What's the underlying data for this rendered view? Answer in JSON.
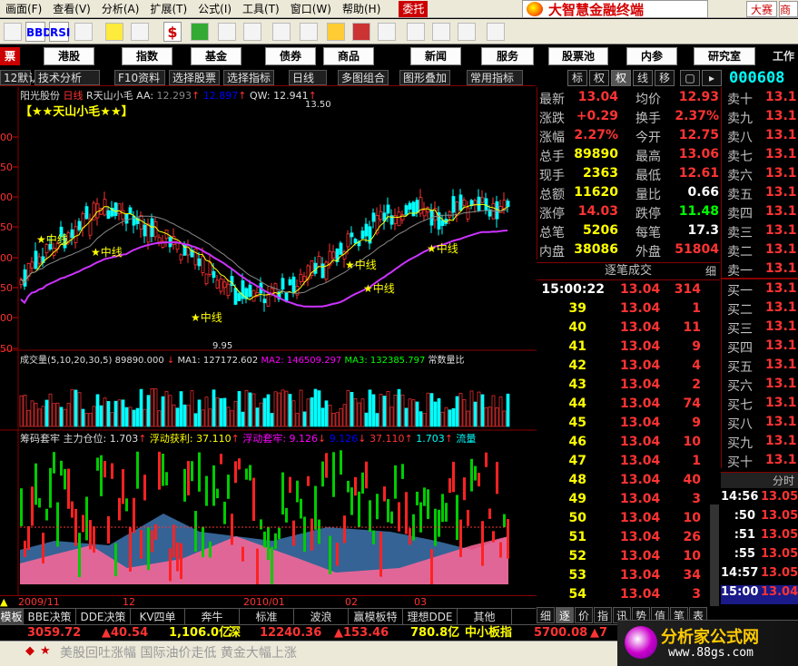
{
  "menu": [
    "画面(F)",
    "查看(V)",
    "分析(A)",
    "扩展(T)",
    "公式(I)",
    "工具(T)",
    "窗口(W)",
    "帮助(H)"
  ],
  "trust": "委托",
  "brand": "大智慧金融终端",
  "dasai": "大赛",
  "shang": "商",
  "toolbar": {
    "bbd": "BBD",
    "rsi": "RSI",
    "dollar": "$"
  },
  "nav": {
    "first": "票",
    "items": [
      "港股",
      "指数",
      "基金",
      "债券",
      "商品",
      "新闻",
      "服务",
      "股票池",
      "内参",
      "研究室"
    ],
    "extra": "工作"
  },
  "toolrow": [
    "12默认",
    "技术分析",
    "F10资料",
    "选择股票",
    "选择指标",
    "日线",
    "多图组合",
    "图形叠加",
    "常用指标"
  ],
  "tabs": [
    "标",
    "权",
    "权",
    "线",
    "移"
  ],
  "stock_code": "000608",
  "chart": {
    "stock_name": "阳光股份",
    "period": "日线",
    "formula": "R天山小毛",
    "aa_label": "AA:",
    "aa_value": "12.293",
    "bb_value": "12.897",
    "qw_label": "QW:",
    "qw_value": "12.941",
    "title_tag": "【★★天山小毛★★】",
    "high_price": "13.50",
    "low_price": "9.95",
    "middle_label": "★中线",
    "y_ticks": [
      "00",
      "50",
      "00",
      "50",
      "00",
      "50",
      "00",
      "50",
      "00",
      "50"
    ],
    "vol": {
      "title": "成交量(5,10,20,30,5)",
      "v": "89890.000",
      "ma1": "MA1: 127172.602",
      "ma2": "MA2: 146509.297",
      "ma3": "MA3: 132385.797",
      "tail": "常数量比"
    },
    "chip": {
      "title": "筹码套牢",
      "main": "主力仓位: 1.703",
      "float_profit": "浮动获利: 37.110",
      "float_loss": "浮动套牢: 9.126",
      "v1": "9.126",
      "v2": "37.110",
      "v3": "1.703",
      "end": "流量"
    },
    "x_labels": [
      "2009/11",
      "12",
      "2010/01",
      "02",
      "03"
    ]
  },
  "quote": [
    [
      "最新",
      "13.04",
      "均价",
      "12.93"
    ],
    [
      "涨跌",
      "+0.29",
      "换手",
      "2.37%"
    ],
    [
      "涨幅",
      "2.27%",
      "今开",
      "12.75"
    ],
    [
      "总手",
      "89890",
      "最高",
      "13.06"
    ],
    [
      "现手",
      "2363",
      "最低",
      "12.61"
    ],
    [
      "总额",
      "11620",
      "量比",
      "0.66"
    ],
    [
      "涨停",
      "14.03",
      "跌停",
      "11.48"
    ],
    [
      "总笔",
      "5206",
      "每笔",
      "17.3"
    ],
    [
      "内盘",
      "38086",
      "外盘",
      "51804"
    ]
  ],
  "ticks_head": "逐笔成交",
  "ticks_detail": "细",
  "ticks": [
    [
      "15:00:22",
      "13.04",
      "314"
    ],
    [
      "39",
      "13.04",
      "1"
    ],
    [
      "40",
      "13.04",
      "11"
    ],
    [
      "41",
      "13.04",
      "9"
    ],
    [
      "42",
      "13.04",
      "4"
    ],
    [
      "43",
      "13.04",
      "2"
    ],
    [
      "44",
      "13.04",
      "74"
    ],
    [
      "45",
      "13.04",
      "9"
    ],
    [
      "46",
      "13.04",
      "10"
    ],
    [
      "47",
      "13.04",
      "1"
    ],
    [
      "48",
      "13.04",
      "40"
    ],
    [
      "49",
      "13.04",
      "3"
    ],
    [
      "50",
      "13.04",
      "10"
    ],
    [
      "51",
      "13.04",
      "26"
    ],
    [
      "52",
      "13.04",
      "10"
    ],
    [
      "53",
      "13.04",
      "34"
    ],
    [
      "54",
      "13.04",
      "3"
    ]
  ],
  "depth": {
    "sell": [
      [
        "卖十",
        "13.1"
      ],
      [
        "卖九",
        "13.1"
      ],
      [
        "卖八",
        "13.1"
      ],
      [
        "卖七",
        "13.1"
      ],
      [
        "卖六",
        "13.1"
      ],
      [
        "卖五",
        "13.1"
      ],
      [
        "卖四",
        "13.1"
      ],
      [
        "卖三",
        "13.1"
      ],
      [
        "卖二",
        "13.1"
      ],
      [
        "卖一",
        "13.1"
      ]
    ],
    "buy": [
      [
        "买一",
        "13.1"
      ],
      [
        "买二",
        "13.1"
      ],
      [
        "买三",
        "13.1"
      ],
      [
        "买四",
        "13.1"
      ],
      [
        "买五",
        "13.1"
      ],
      [
        "买六",
        "13.1"
      ],
      [
        "买七",
        "13.1"
      ],
      [
        "买八",
        "13.1"
      ],
      [
        "买九",
        "13.1"
      ],
      [
        "买十",
        "13.1"
      ]
    ]
  },
  "fenshi_head": "分时",
  "fenshi": [
    [
      "14:56",
      "13.05"
    ],
    [
      ":50",
      "13.05"
    ],
    [
      ":51",
      "13.05"
    ],
    [
      ":55",
      "13.05"
    ],
    [
      "14:57",
      "13.05"
    ],
    [
      "15:00",
      "13.04"
    ]
  ],
  "btabs": [
    "模板",
    "BBE决策",
    "DDE决策",
    "KV四单",
    "奔牛",
    "标准",
    "波浪",
    "赢模板特",
    "理想DDE",
    "其他"
  ],
  "rtabs": [
    "细",
    "逐",
    "价",
    "指",
    "讯",
    "势",
    "值",
    "笔",
    "表"
  ],
  "status": {
    "sh_index": "3059.72",
    "sh_change": "▲40.54",
    "sh_amount": "1,106.0亿",
    "sz_label": "深",
    "sz_index": "12240.36",
    "sz_change": "▲153.46",
    "sz_amount": "780.8亿",
    "mid_label": "中小板指",
    "mid_index": "5700.08",
    "mid_change": "▲7"
  },
  "ticker": "美股回吐涨幅 国际油价走低 黄金大幅上涨",
  "watermark": {
    "title": "分析家公式网",
    "url": "www.88gs.com"
  }
}
